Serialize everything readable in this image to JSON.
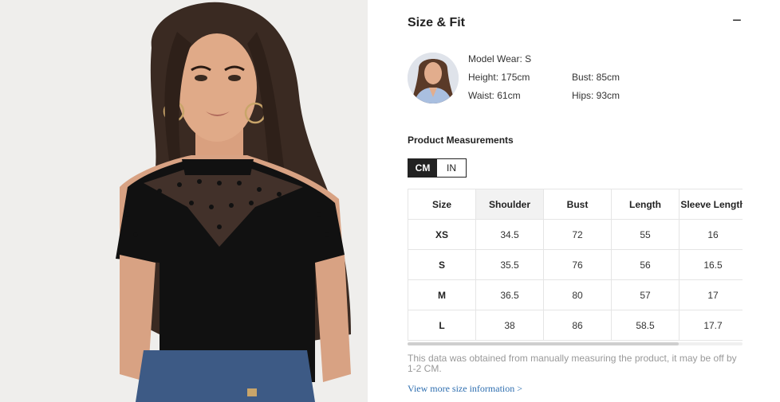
{
  "size_fit": {
    "title": "Size & Fit",
    "collapse_icon": "−"
  },
  "model": {
    "wear": "Model Wear: S",
    "height": "Height: 175cm",
    "bust": "Bust: 85cm",
    "waist": "Waist: 61cm",
    "hips": "Hips: 93cm"
  },
  "measurements": {
    "title": "Product Measurements",
    "units": [
      "CM",
      "IN"
    ],
    "active_unit": "CM",
    "headers": [
      "Size",
      "Shoulder",
      "Bust",
      "Length",
      "Sleeve Length"
    ],
    "rows": [
      [
        "XS",
        "34.5",
        "72",
        "55",
        "16"
      ],
      [
        "S",
        "35.5",
        "76",
        "56",
        "16.5"
      ],
      [
        "M",
        "36.5",
        "80",
        "57",
        "17"
      ],
      [
        "L",
        "38",
        "86",
        "58.5",
        "17.7"
      ]
    ]
  },
  "note": "This data was obtained from manually measuring the product, it may be off by 1-2 CM.",
  "more_link": "View more size information >"
}
